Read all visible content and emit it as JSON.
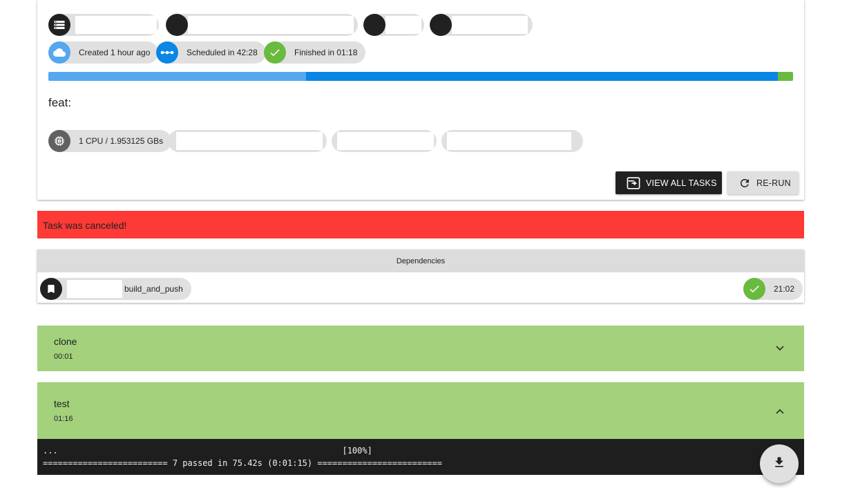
{
  "build": {
    "created_label": "Created 1 hour ago",
    "scheduled_label": "Scheduled in 42:28",
    "finished_label": "Finished in 01:18",
    "progress_segments": [
      {
        "name": "created",
        "fraction": 0.346,
        "color": "#55a7ef"
      },
      {
        "name": "scheduled",
        "fraction": 0.634,
        "color": "#0a86e5"
      },
      {
        "name": "finished",
        "fraction": 0.02,
        "color": "#69bb3f"
      }
    ],
    "title": "feat:",
    "resources_label": "1 CPU / 1.953125 GBs"
  },
  "actions": {
    "view_all_label": "VIEW ALL TASKS",
    "rerun_label": "RE-RUN"
  },
  "alert": {
    "message": "Task was canceled!"
  },
  "dependencies": {
    "header": "Dependencies",
    "item": {
      "name": "build_and_push",
      "duration": "21:02"
    }
  },
  "tasks": [
    {
      "name": "clone",
      "duration": "00:01",
      "expanded": false
    },
    {
      "name": "test",
      "duration": "01:16",
      "expanded": true
    }
  ],
  "log": {
    "lines": [
      "...                                                         [100%]",
      "========================= 7 passed in 75.42s (0:01:15) ========================="
    ]
  },
  "colors": {
    "success": "#a3d17c",
    "check": "#69bb3f",
    "alert": "#fd3a36",
    "dark": "#212121",
    "chip": "#e0e0e0"
  },
  "icons": [
    "storage-icon",
    "cloud-icon",
    "timeline-icon",
    "check-icon",
    "memory-icon",
    "launch-icon",
    "refresh-icon",
    "bookmark-icon",
    "chevron-down-icon",
    "chevron-up-icon",
    "download-icon"
  ]
}
